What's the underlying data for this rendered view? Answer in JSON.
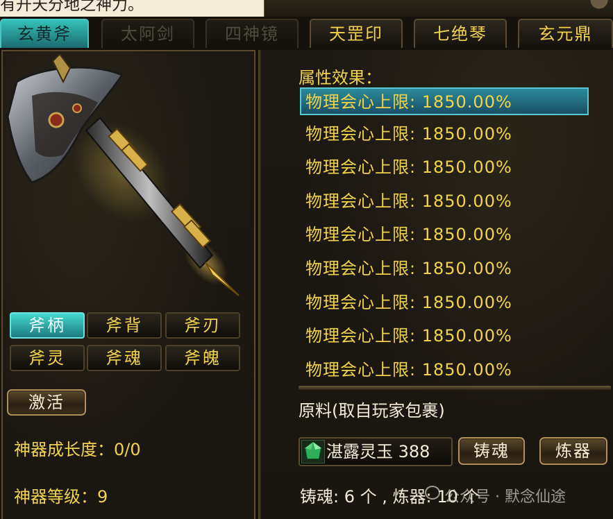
{
  "header": {
    "caption": "有开天分地之神力。"
  },
  "tabs": [
    {
      "label": "玄黄斧",
      "state": "active"
    },
    {
      "label": "太阿剑",
      "state": "dim"
    },
    {
      "label": "四神镜",
      "state": "dim"
    },
    {
      "label": "天罡印",
      "state": "normal"
    },
    {
      "label": "七绝琴",
      "state": "normal"
    },
    {
      "label": "玄元鼎",
      "state": "normal"
    }
  ],
  "parts": [
    {
      "label": "斧柄",
      "active": true
    },
    {
      "label": "斧背",
      "active": false
    },
    {
      "label": "斧刃",
      "active": false
    },
    {
      "label": "斧灵",
      "active": false
    },
    {
      "label": "斧魂",
      "active": false
    },
    {
      "label": "斧魄",
      "active": false
    }
  ],
  "activate_label": "激活",
  "stats": {
    "growth": "神器成长度：0/0",
    "level": "神器等级：9"
  },
  "attributes": {
    "title": "属性效果：",
    "rows": [
      "物理会心上限: 1850.00%",
      "物理会心上限: 1850.00%",
      "物理会心上限: 1850.00%",
      "物理会心上限: 1850.00%",
      "物理会心上限: 1850.00%",
      "物理会心上限: 1850.00%",
      "物理会心上限: 1850.00%",
      "物理会心上限: 1850.00%",
      "物理会心上限: 1850.00%"
    ]
  },
  "materials": {
    "title": "原料(取自玩家包裹)",
    "item": "湛露灵玉 388",
    "cast_label": "铸魂",
    "refine_label": "炼器",
    "bottom_text": "铸魂: 6 个 , 炼器: 10 个"
  },
  "watermark": "公众号 · 默念仙途",
  "colors": {
    "gold_text": "#f2d34a",
    "active_teal": "#35c1b8",
    "panel_bg": "#1a1610"
  }
}
